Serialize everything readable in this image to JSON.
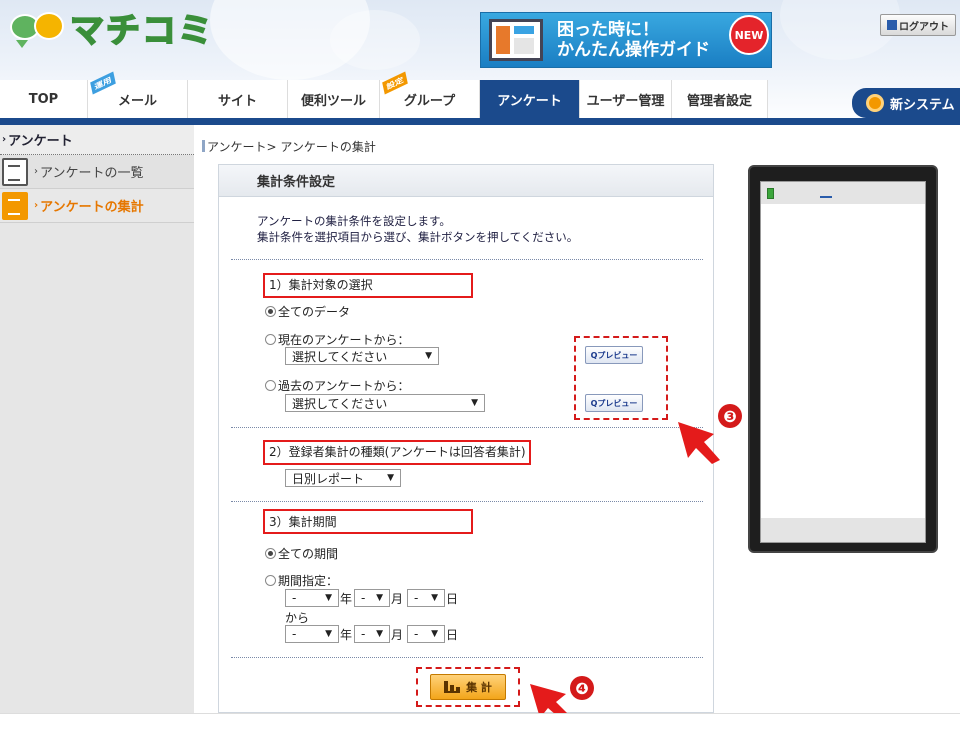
{
  "header": {
    "logo_text": "マチコミ",
    "banner": {
      "line1": "困った時に！",
      "line2": "かんたん操作ガイド",
      "badge": "NEW"
    },
    "logout_label": "ログアウト"
  },
  "nav": {
    "tabs": [
      {
        "label": "TOP",
        "tag": ""
      },
      {
        "label": "メール",
        "tag": "運用"
      },
      {
        "label": "サイト",
        "tag": ""
      },
      {
        "label": "便利ツール",
        "tag": ""
      },
      {
        "label": "グループ",
        "tag": "設定"
      },
      {
        "label": "アンケート",
        "tag": "",
        "active": true
      },
      {
        "label": "ユーザー管理",
        "tag": ""
      },
      {
        "label": "管理者設定",
        "tag": ""
      }
    ],
    "new_system_label": "新システム"
  },
  "sidebar": {
    "title": "アンケート",
    "items": [
      {
        "label": "アンケートの一覧",
        "icon": "document-list-icon"
      },
      {
        "label": "アンケートの集計",
        "icon": "aggregate-icon",
        "active": true
      }
    ]
  },
  "breadcrumb": "アンケート> アンケートの集計",
  "panel": {
    "title": "集計条件設定",
    "intro_line1": "アンケートの集計条件を設定します。",
    "intro_line2": "集計条件を選択項目から選び、集計ボタンを押してください。",
    "section1": {
      "label": "1）集計対象の選択",
      "all_data": "全てのデータ",
      "current_label": "現在のアンケートから：",
      "current_select": "選択してください",
      "past_label": "過去のアンケートから：",
      "past_select": "選択してください",
      "preview_label": "Qプレビュー"
    },
    "section2": {
      "label": "2）登録者集計の種類(アンケートは回答者集計)",
      "select": "日別レポート"
    },
    "section3": {
      "label": "3）集計期間",
      "all_period": "全ての期間",
      "specify_label": "期間指定：",
      "dash": "-",
      "year": "年",
      "month": "月",
      "day": "日",
      "from": "から"
    },
    "aggregate_label": "集 計"
  },
  "annotations": {
    "marker3": "❸",
    "marker4": "❹"
  }
}
